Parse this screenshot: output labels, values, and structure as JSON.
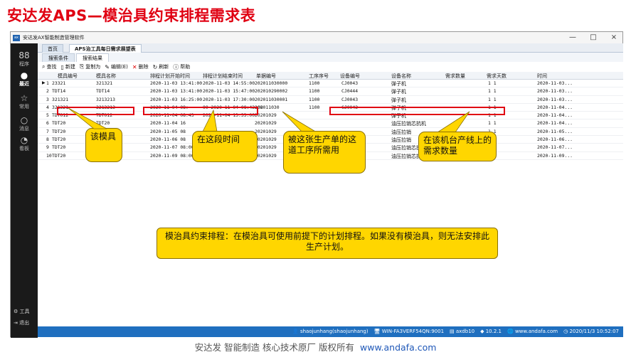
{
  "slide_title": "安达发APS—模治具约束排程需求表",
  "app": {
    "title": "安达发AX智能制造管理软件",
    "window_buttons": [
      "—",
      "□",
      "×"
    ]
  },
  "sidebar": {
    "items": [
      {
        "icon": "88",
        "label": "程序"
      },
      {
        "icon": "●",
        "label": "最近"
      },
      {
        "icon": "☆",
        "label": "常用"
      },
      {
        "icon": "○",
        "label": "消息"
      },
      {
        "icon": "◔",
        "label": "看板"
      }
    ],
    "tools_label": "工具",
    "exit_label": "退出"
  },
  "tabs": {
    "home": "首页",
    "report": "APS治工具每日需求展望表"
  },
  "subtabs": {
    "conditions": "搜索条件",
    "results": "搜索结果"
  },
  "toolbar": {
    "query": "查找",
    "new": "新建",
    "copy": "复制为",
    "edit": "编辑(E)",
    "delete": "删除",
    "refresh": "刷新",
    "help": "帮助"
  },
  "table": {
    "headers": [
      "模具编号",
      "模具名称",
      "排程计划开始时间",
      "排程计划结束时间",
      "单据编号",
      "工序序号",
      "设备编号",
      "设备名称",
      "需求数量",
      "需求天数",
      "时间"
    ],
    "rows": [
      {
        "num": "1",
        "mold_no": "23321",
        "mold_name": "321321",
        "start": "2020-11-03 13:41:00",
        "end": "2020-11-03 14:55:00",
        "doc_no": "202011030000",
        "op_seq": "1100",
        "equip_no": "CJ0043",
        "equip_name": "弹子机",
        "qty": "",
        "days": "1 1",
        "time": "2020-11-03..."
      },
      {
        "num": "2",
        "mold_no": "TDT14",
        "mold_name": "TDT14",
        "start": "2020-11-03 13:41:00",
        "end": "2020-11-03 15:47:00",
        "doc_no": "202010290002",
        "op_seq": "1100",
        "equip_no": "CJ0444",
        "equip_name": "弹子机",
        "qty": "",
        "days": "1 1",
        "time": "2020-11-03..."
      },
      {
        "num": "3",
        "mold_no": "321321",
        "mold_name": "3213213",
        "start": "2020-11-03 16:25:00",
        "end": "2020-11-03 17:30:00",
        "doc_no": "202011030001",
        "op_seq": "1100",
        "equip_no": "CJ0043",
        "equip_name": "弹子机",
        "qty": "",
        "days": "1 1",
        "time": "2020-11-03..."
      },
      {
        "num": "4",
        "mold_no": "321321",
        "mold_name": "3213213",
        "start": "2020-11-04 08:",
        "end": "00 2020-11-04 08:43:00",
        "doc_no": "202011030",
        "op_seq": "1100",
        "equip_no": "CJ0043",
        "equip_name": "弹子机",
        "qty": "",
        "days": "1 1",
        "time": "2020-11-04..."
      },
      {
        "num": "5",
        "mold_no": "TDT012",
        "mold_name": "TDT012",
        "start": "2020-11-04 08:43",
        "end": "2020-11-04 13:33:00",
        "doc_no": "20201029",
        "op_seq": "",
        "equip_no": "",
        "equip_name": "弹子机",
        "qty": "",
        "days": "1 1",
        "time": "2020-11-04..."
      },
      {
        "num": "6",
        "mold_no": "TDT20",
        "mold_name": "TDT20",
        "start": "2020-11-04 16",
        "end": "",
        "doc_no": "20201029",
        "op_seq": "",
        "equip_no": "",
        "equip_name": "油压拉销芯抗机",
        "qty": "",
        "days": "1 1",
        "time": "2020-11-04..."
      },
      {
        "num": "7",
        "mold_no": "TDT20",
        "mold_name": "TDT20",
        "start": "2020-11-05 08",
        "end": "",
        "doc_no": "20201029",
        "op_seq": "",
        "equip_no": "",
        "equip_name": "油压拉销",
        "qty": "",
        "days": "1 1",
        "time": "2020-11-05..."
      },
      {
        "num": "8",
        "mold_no": "TDT20",
        "mold_name": "TDT20",
        "start": "2020-11-06 08",
        "end": "",
        "doc_no": "20201029",
        "op_seq": "",
        "equip_no": "",
        "equip_name": "油压拉销",
        "qty": "",
        "days": "1 1",
        "time": "2020-11-06..."
      },
      {
        "num": "9",
        "mold_no": "TDT20",
        "mold_name": "TDT20",
        "start": "2020-11-07 08:00:00",
        "end": "2020-11-07 17:30:00",
        "doc_no": "20201029",
        "op_seq": "",
        "equip_no": "",
        "equip_name": "油压拉销芯抗机",
        "qty": "",
        "days": "1 1",
        "time": "2020-11-07..."
      },
      {
        "num": "10",
        "mold_no": "TDT20",
        "mold_name": "TDT20",
        "start": "2020-11-09 08:00:00",
        "end": "2020-11-09 11:03:00",
        "doc_no": "20201029",
        "op_seq": "",
        "equip_no": "",
        "equip_name": "油压拉销芯抗机",
        "qty": "",
        "days": "1 1",
        "time": "2020-11-09..."
      }
    ]
  },
  "callouts": {
    "mold": "该模具",
    "period": "在这段时间",
    "order": "被这张生产单的这道工序所需用",
    "demand": "在该机台产线上的需求数量",
    "note": "模治具约束排程：在模治具可使用前提下的计划排程。如果没有模治具，则无法安排此生产计划。"
  },
  "statusbar": {
    "user": "shaojunhang(shaojunhang)",
    "host": "WIN-FA3VERF54QN:9001",
    "db": "axdb10",
    "version": "10.2.1",
    "site": "www.andafa.com",
    "datetime": "2020/11/3 10:52:07"
  },
  "footer": {
    "text": "安达发  智能制造 核心技术原厂  版权所有",
    "url": "www.andafa.com"
  },
  "colors": {
    "title_red": "#e00012",
    "callout_yellow": "#ffd600",
    "status_blue": "#1f6fbf",
    "sidebar_dark": "#1a1a1a"
  }
}
